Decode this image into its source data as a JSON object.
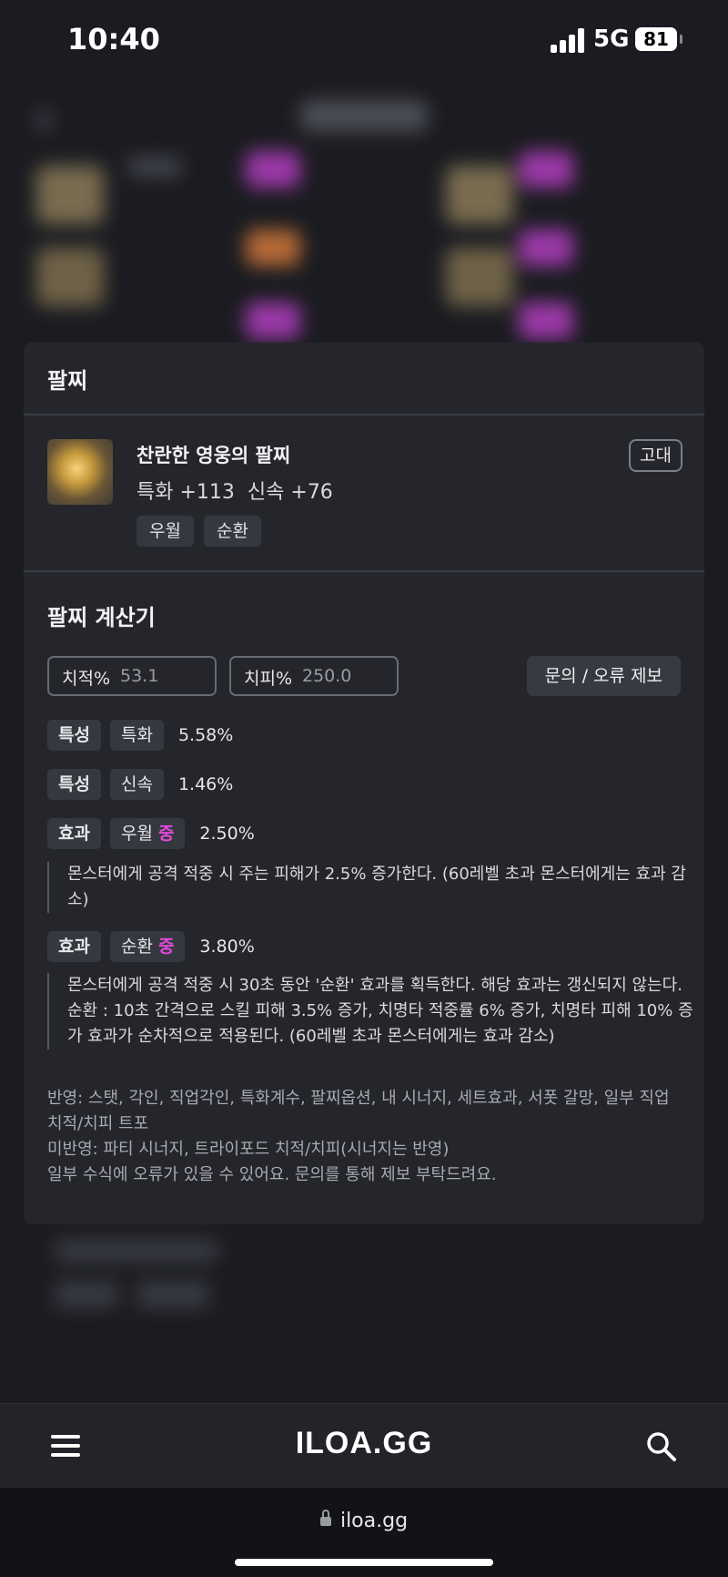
{
  "status_bar": {
    "time": "10:40",
    "network": "5G",
    "battery": "81"
  },
  "bracelet": {
    "section_title": "팔찌",
    "item_name": "찬란한 영웅의 팔찌",
    "stats": [
      "특화 +113",
      "신속 +76"
    ],
    "tags": [
      "우월",
      "순환"
    ],
    "grade": "고대"
  },
  "calculator": {
    "title": "팔찌 계산기",
    "crit_label": "치적%",
    "crit_value": "53.1",
    "critdmg_label": "치피%",
    "critdmg_value": "250.0",
    "report_button": "문의 / 오류 제보",
    "rows": [
      {
        "type": "특성",
        "name": "특화",
        "value": "5.58%"
      },
      {
        "type": "특성",
        "name": "신속",
        "value": "1.46%"
      },
      {
        "type": "효과",
        "name": "우월",
        "level": "중",
        "value": "2.50%",
        "desc": "몬스터에게 공격 적중 시 주는 피해가 2.5% 증가한다. (60레벨 초과 몬스터에게는 효과 감소)"
      },
      {
        "type": "효과",
        "name": "순환",
        "level": "중",
        "value": "3.80%",
        "desc": "몬스터에게 공격 적중 시 30초 동안 '순환' 효과를 획득한다. 해당 효과는 갱신되지 않는다. 순환 : 10초 간격으로 스킬 피해 3.5% 증가, 치명타 적중률 6% 증가, 치명타 피해 10% 증가 효과가 순차적으로 적용된다. (60레벨 초과 몬스터에게는 효과 감소)"
      }
    ],
    "notes": [
      "반영: 스탯, 각인, 직업각인, 특화계수, 팔찌옵션, 내 시너지, 세트효과, 서폿 갈망, 일부 직업 치적/치피 트포",
      "미반영: 파티 시너지, 트라이포드 치적/치피(시너지는 반영)",
      "일부 수식에 오류가 있을 수 있어요. 문의를 통해 제보 부탁드려요."
    ]
  },
  "nav": {
    "logo": "ILOA.GG"
  },
  "browser": {
    "url": "iloa.gg"
  },
  "colors": {
    "accent_level": "#e04bd9",
    "card_bg": "#25262c",
    "page_bg": "#1b1c21"
  }
}
